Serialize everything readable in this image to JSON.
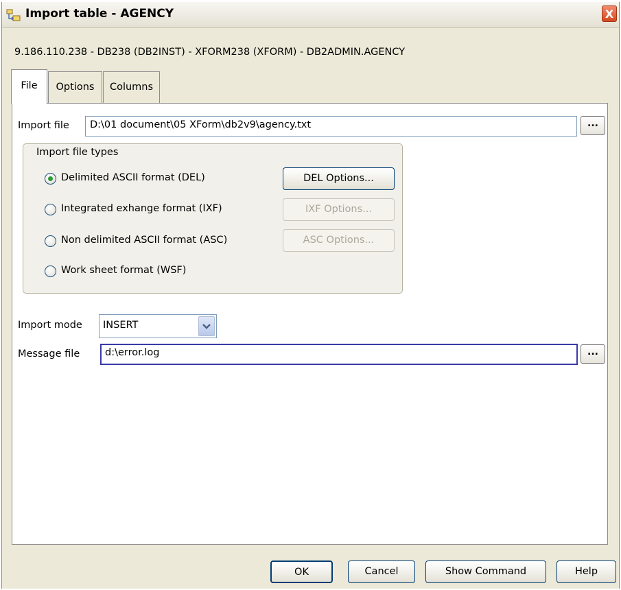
{
  "window": {
    "title": "Import table - AGENCY",
    "close_glyph": "X",
    "icon": "table-import-icon"
  },
  "connection": {
    "info": "9.186.110.238 - DB238 (DB2INST)  - XFORM238 (XFORM) - DB2ADMIN.AGENCY"
  },
  "tabs": [
    {
      "label": "File",
      "active": true
    },
    {
      "label": "Options",
      "active": false
    },
    {
      "label": "Columns",
      "active": false
    }
  ],
  "file_tab": {
    "import_file": {
      "label": "Import file",
      "value": "D:\\01 document\\05 XForm\\db2v9\\agency.txt",
      "browse_label": "..."
    },
    "file_types": {
      "group_label": "Import file types",
      "options": [
        {
          "label": "Delimited ASCII format (DEL)",
          "selected": true,
          "button": "DEL Options...",
          "button_enabled": true
        },
        {
          "label": "Integrated exhange format (IXF)",
          "selected": false,
          "button": "IXF Options...",
          "button_enabled": false
        },
        {
          "label": "Non delimited ASCII format (ASC)",
          "selected": false,
          "button": "ASC Options...",
          "button_enabled": false
        },
        {
          "label": "Work sheet format (WSF)",
          "selected": false
        }
      ]
    },
    "import_mode": {
      "label": "Import mode",
      "value": "INSERT"
    },
    "message_file": {
      "label": "Message file",
      "value": "d:\\error.log",
      "browse_label": "..."
    }
  },
  "footer": {
    "ok": "OK",
    "cancel": "Cancel",
    "show_command": "Show Command",
    "help": "Help"
  },
  "colors": {
    "dialog_bg": "#ece9d8",
    "panel_bg": "#ffffff",
    "radio_dot": "#2e9b35",
    "close_button": "#d34a22",
    "focus_border": "#3a3aa8"
  }
}
